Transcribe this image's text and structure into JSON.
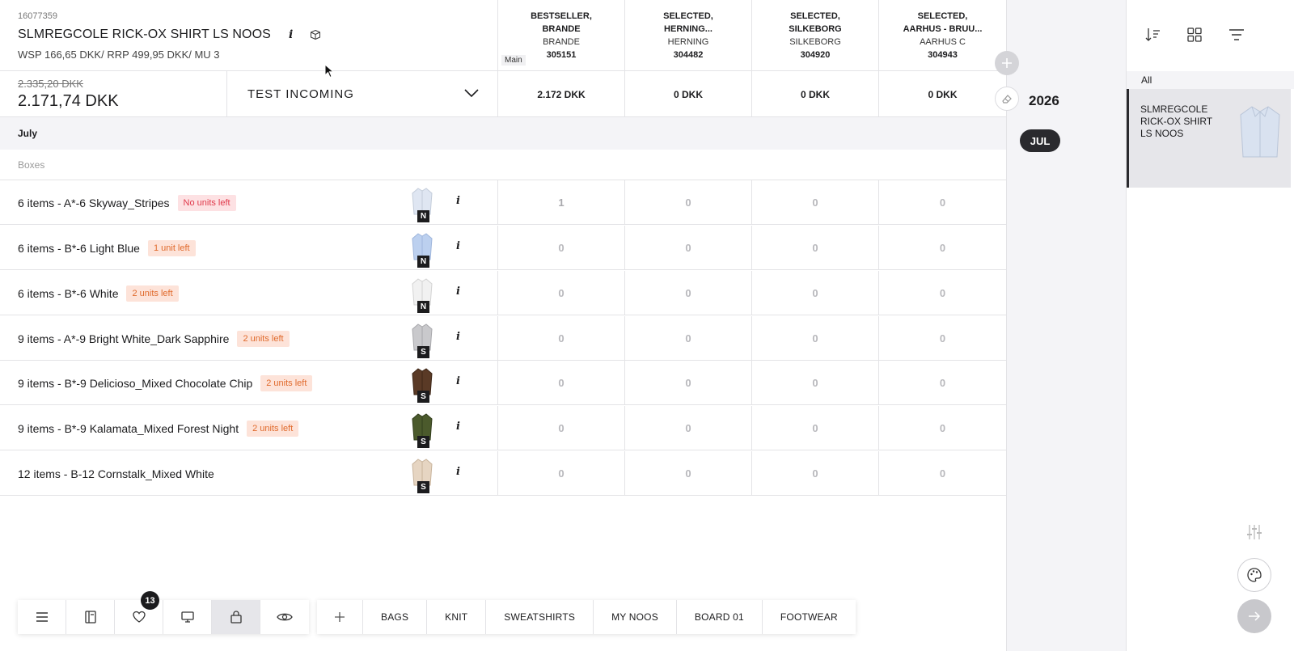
{
  "product": {
    "id": "16077359",
    "name": "SLMREGCOLE RICK-OX SHIRT LS NOOS",
    "price_line": "WSP 166,65 DKK/ RRP 499,95 DKK/ MU 3",
    "old_total": "2.335,20 DKK",
    "total": "2.171,74 DKK"
  },
  "selection": {
    "label": "TEST INCOMING"
  },
  "main_tag": "Main",
  "stores": [
    {
      "name1": "BESTSELLER,",
      "name2": "BRANDE",
      "city": "BRANDE",
      "num": "305151",
      "amount": "2.172 DKK"
    },
    {
      "name1": "SELECTED,",
      "name2": "HERNING...",
      "city": "HERNING",
      "num": "304482",
      "amount": "0 DKK"
    },
    {
      "name1": "SELECTED,",
      "name2": "SILKEBORG",
      "city": "SILKEBORG",
      "num": "304920",
      "amount": "0 DKK"
    },
    {
      "name1": "SELECTED,",
      "name2": "AARHUS - BRUU...",
      "city": "AARHUS C",
      "num": "304943",
      "amount": "0 DKK"
    }
  ],
  "month": "July",
  "section": "Boxes",
  "items": [
    {
      "name": "6 items - A*-6 Skyway_Stripes",
      "badge": "No units left",
      "size": "N",
      "qty": [
        "1",
        "0",
        "0",
        "0"
      ]
    },
    {
      "name": "6 items - B*-6 Light Blue",
      "badge": "1 unit left",
      "size": "N",
      "qty": [
        "0",
        "0",
        "0",
        "0"
      ]
    },
    {
      "name": "6 items - B*-6 White",
      "badge": "2 units left",
      "size": "N",
      "qty": [
        "0",
        "0",
        "0",
        "0"
      ]
    },
    {
      "name": "9 items - A*-9 Bright White_Dark Sapphire",
      "badge": "2 units left",
      "size": "S",
      "qty": [
        "0",
        "0",
        "0",
        "0"
      ]
    },
    {
      "name": "9 items - B*-9 Delicioso_Mixed Chocolate Chip",
      "badge": "2 units left",
      "size": "S",
      "qty": [
        "0",
        "0",
        "0",
        "0"
      ]
    },
    {
      "name": "9 items - B*-9 Kalamata_Mixed Forest Night",
      "badge": "2 units left",
      "size": "S",
      "qty": [
        "0",
        "0",
        "0",
        "0"
      ]
    },
    {
      "name": "12 items - B-12 Cornstalk_Mixed White",
      "badge": "",
      "size": "S",
      "qty": [
        "0",
        "0",
        "0",
        "0"
      ]
    }
  ],
  "timeline": {
    "year": "2026",
    "month_pill": "JUL"
  },
  "sidebar": {
    "filter_all": "All",
    "card_name": "SLMREGCOLE RICK-OX SHIRT LS NOOS"
  },
  "toolbar": {
    "favorites_count": "13"
  },
  "boards": [
    "BAGS",
    "KNIT",
    "SWEATSHIRTS",
    "MY NOOS",
    "BOARD 01",
    "FOOTWEAR"
  ],
  "colors": {
    "accent": "#2a2a2e",
    "badge_red": "#e0394b",
    "badge_orange": "#e06a2c"
  }
}
